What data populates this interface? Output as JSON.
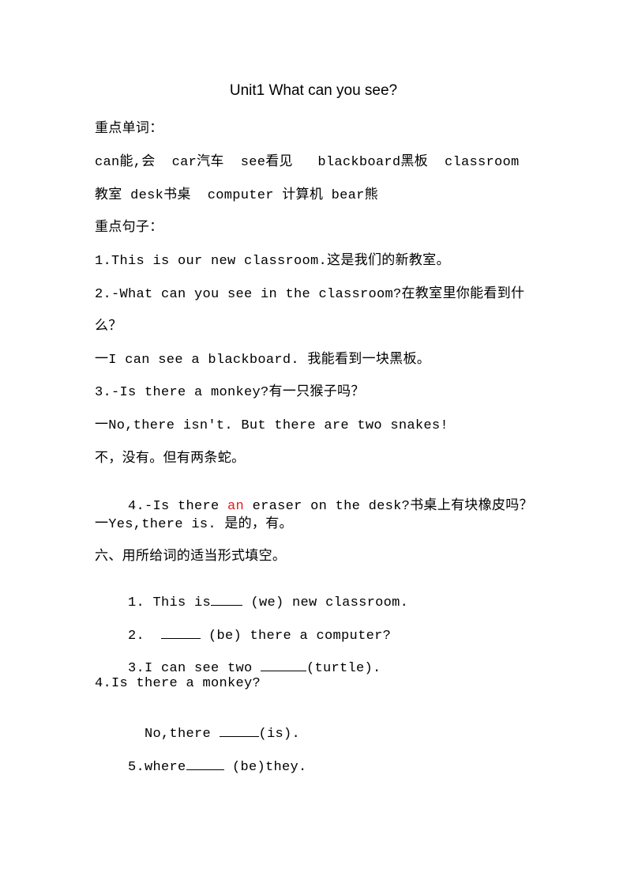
{
  "title": "Unit1 What can you see?",
  "vocab_heading": "重点单词：",
  "vocab_line1": "can能,会  car汽车  see看见   blackboard黑板  classroom",
  "vocab_line2": "教室 desk书桌  computer 计算机 bear熊",
  "sentences_heading": "重点句子：",
  "sentences": {
    "s1": "1.This is our new classroom.这是我们的新教室。",
    "s2a": "2.-What can you see in the classroom?在教室里你能看到什",
    "s2b": "么？",
    "s2c": "一I can see a blackboard. 我能看到一块黑板。",
    "s3a": "3.-Is there a monkey?有一只猴子吗？",
    "s3b": "一No,there isn't. But there are two snakes!",
    "s3c": "不，没有。但有两条蛇。",
    "s4a_pre": "4.-Is there ",
    "s4a_red": "an",
    "s4a_post": " eraser on the desk?书桌上有块橡皮吗？",
    "s4b": "一Yes,there is. 是的，有。"
  },
  "exercise_heading": "六、用所给词的适当形式填空。",
  "exercises": {
    "e1_pre": "1. This is",
    "e1_post": " (we) new classroom.",
    "e2_pre": "2. ",
    "e2_post": " (be) there a computer?",
    "e3_pre": "3.I can see two ",
    "e3_post": "(turtle).",
    "e4a": "4.Is there a monkey?",
    "e4b_pre": "  No,there ",
    "e4b_post": "(is).",
    "e5_pre": "5.where",
    "e5_post": " (be)they."
  },
  "colors": {
    "highlight": "#e8191b"
  }
}
